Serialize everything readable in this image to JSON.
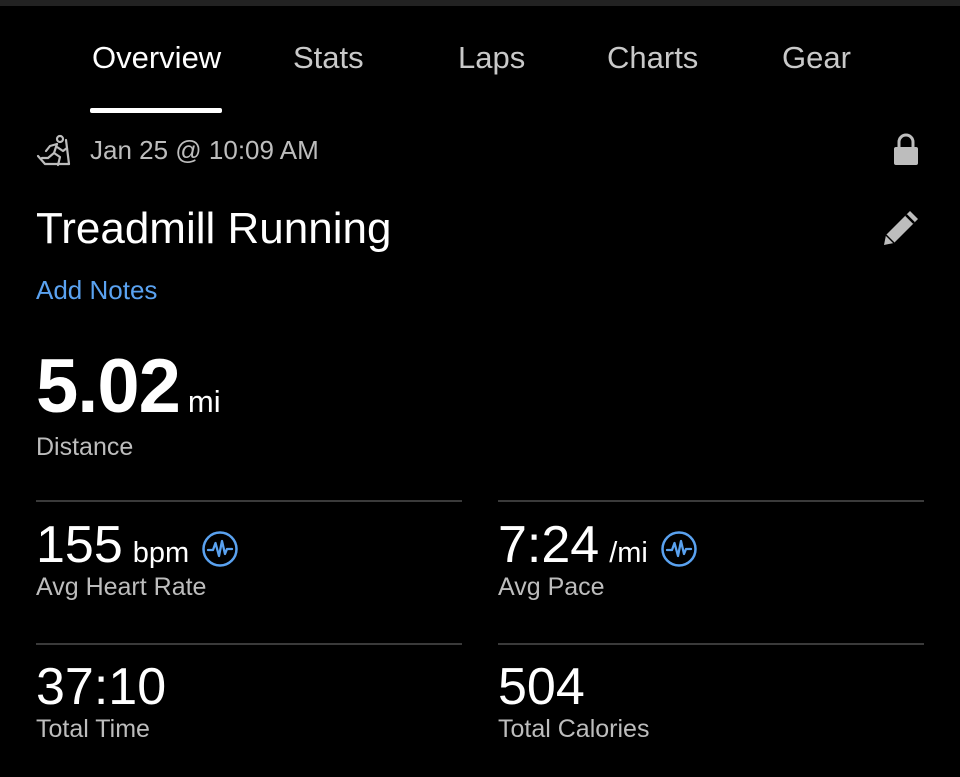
{
  "tabs": [
    {
      "label": "Overview",
      "active": true
    },
    {
      "label": "Stats",
      "active": false
    },
    {
      "label": "Laps",
      "active": false
    },
    {
      "label": "Charts",
      "active": false
    },
    {
      "label": "Gear",
      "active": false
    }
  ],
  "activity": {
    "datetime": "Jan 25 @ 10:09 AM",
    "type_icon": "treadmill-run-icon",
    "privacy_icon": "lock-icon",
    "title": "Treadmill Running",
    "edit_icon": "pencil-icon",
    "add_notes": "Add Notes"
  },
  "distance": {
    "value": "5.02",
    "unit": "mi",
    "label": "Distance"
  },
  "stats": [
    {
      "value": "155",
      "unit": "bpm",
      "label": "Avg Heart Rate",
      "icon": "heart-rate-sensor-icon"
    },
    {
      "value": "7:24",
      "unit": "/mi",
      "label": "Avg Pace",
      "icon": "heart-rate-sensor-icon"
    },
    {
      "value": "37:10",
      "unit": "",
      "label": "Total Time"
    },
    {
      "value": "504",
      "unit": "",
      "label": "Total Calories"
    }
  ],
  "colors": {
    "accent": "#5aa2f0",
    "background": "#000000",
    "muted_text": "#bdbdbd"
  }
}
